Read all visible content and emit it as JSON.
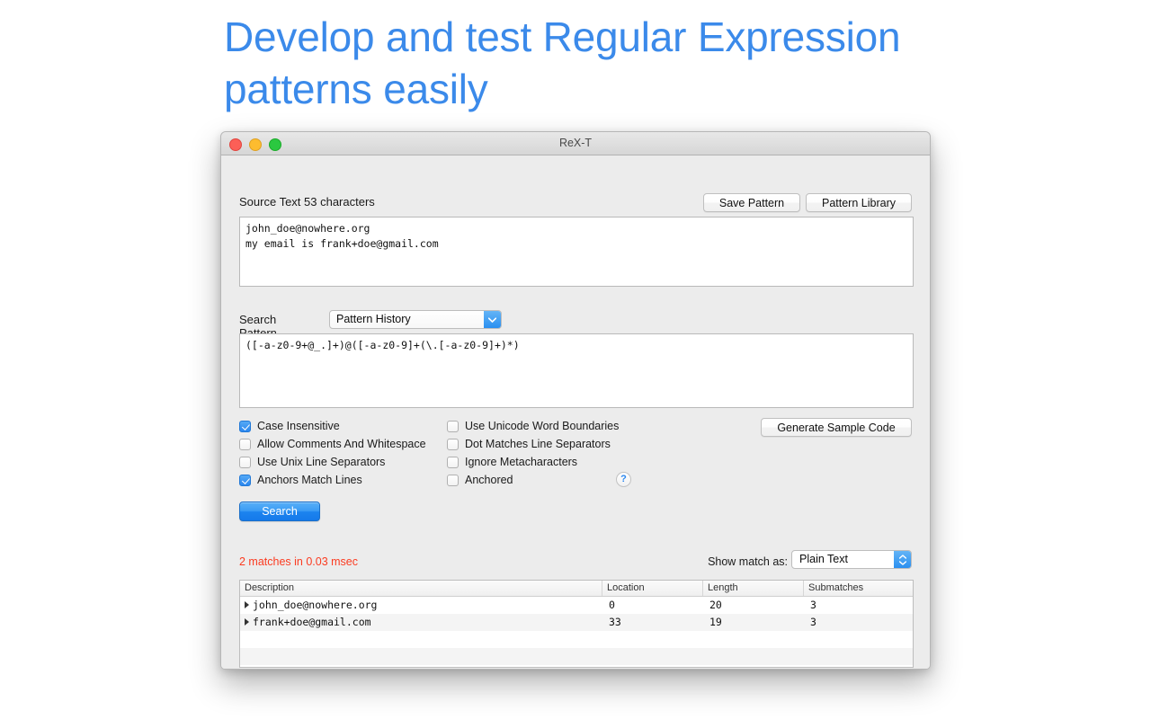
{
  "headline": "Develop and test Regular Expression\npatterns easily",
  "headline_color": "#3b8aea",
  "window": {
    "title": "ReX-T",
    "traffic_lights": [
      "close-button",
      "minimize-button",
      "zoom-button"
    ]
  },
  "source": {
    "label": "Source Text  53 characters",
    "text": "john_doe@nowhere.org\nmy email is frank+doe@gmail.com",
    "save_pattern_label": "Save Pattern",
    "pattern_library_label": "Pattern Library"
  },
  "pattern": {
    "label": "Search Pattern",
    "history_value": "Pattern History",
    "text": "([-a-z0-9+@_.]+)@([-a-z0-9]+(\\.[-a-z0-9]+)*)"
  },
  "options": {
    "left": [
      {
        "label": "Case Insensitive",
        "checked": true
      },
      {
        "label": "Allow Comments And Whitespace",
        "checked": false
      },
      {
        "label": "Use Unix Line Separators",
        "checked": false
      },
      {
        "label": "Anchors Match Lines",
        "checked": true
      }
    ],
    "right": [
      {
        "label": "Use Unicode Word Boundaries",
        "checked": false
      },
      {
        "label": "Dot Matches Line Separators",
        "checked": false
      },
      {
        "label": "Ignore Metacharacters",
        "checked": false
      },
      {
        "label": "Anchored",
        "checked": false
      }
    ],
    "help_label": "?",
    "generate_label": "Generate Sample Code"
  },
  "search_button_label": "Search",
  "results": {
    "status": "2 matches in 0.03 msec",
    "status_color": "#fb3b20",
    "show_match_label": "Show match as:",
    "show_match_value": "Plain Text",
    "columns": [
      "Description",
      "Location",
      "Length",
      "Submatches"
    ],
    "rows": [
      {
        "description": "john_doe@nowhere.org",
        "location": "0",
        "length": "20",
        "submatches": "3"
      },
      {
        "description": "frank+doe@gmail.com",
        "location": "33",
        "length": "19",
        "submatches": "3"
      }
    ]
  }
}
